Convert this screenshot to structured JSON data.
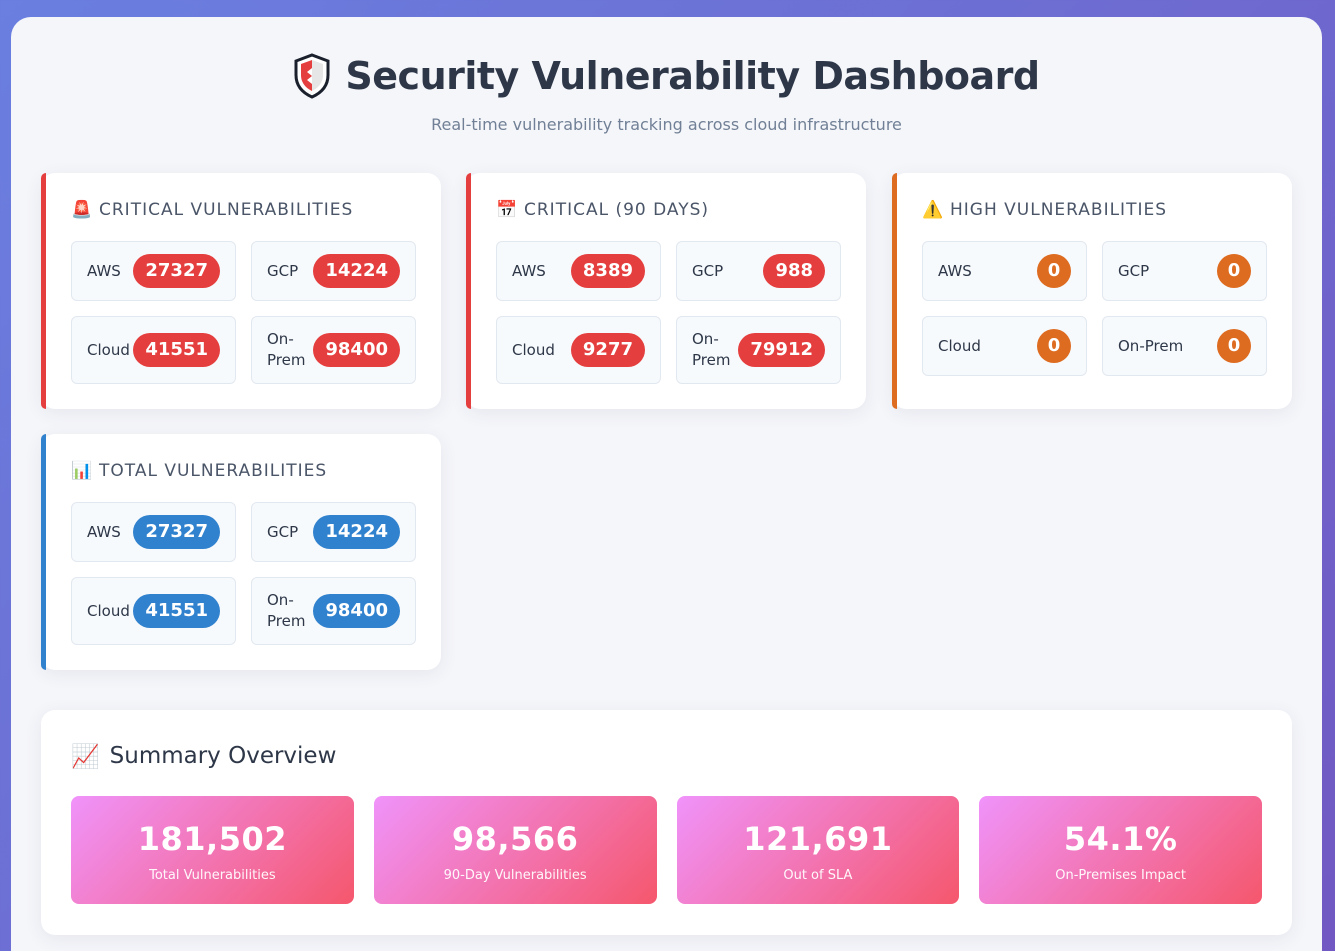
{
  "header": {
    "title": "Security Vulnerability Dashboard",
    "subtitle": "Real-time vulnerability tracking across cloud infrastructure",
    "icon": "shield-icon"
  },
  "colors": {
    "critical": "#e53e3e",
    "high": "#dd6b20",
    "total": "#3182ce",
    "summary_gradient_start": "#f093fb",
    "summary_gradient_end": "#f5576c"
  },
  "cards": {
    "critical": {
      "icon": "siren-icon",
      "icon_glyph": "🚨",
      "title": "Critical Vulnerabilities",
      "aws_label": "AWS",
      "aws_value": "27327",
      "gcp_label": "GCP",
      "gcp_value": "14224",
      "cloud_label": "Cloud",
      "cloud_value": "41551",
      "onprem_label": "On-Prem",
      "onprem_value": "98400"
    },
    "critical_90": {
      "icon": "calendar-icon",
      "icon_glyph": "📅",
      "title": "Critical (90 Days)",
      "aws_label": "AWS",
      "aws_value": "8389",
      "gcp_label": "GCP",
      "gcp_value": "988",
      "cloud_label": "Cloud",
      "cloud_value": "9277",
      "onprem_label": "On-Prem",
      "onprem_value": "79912"
    },
    "high": {
      "icon": "warning-icon",
      "icon_glyph": "⚠️",
      "title": "High Vulnerabilities",
      "aws_label": "AWS",
      "aws_value": "0",
      "gcp_label": "GCP",
      "gcp_value": "0",
      "cloud_label": "Cloud",
      "cloud_value": "0",
      "onprem_label": "On-Prem",
      "onprem_value": "0"
    },
    "total": {
      "icon": "bar-chart-icon",
      "icon_glyph": "📊",
      "title": "Total Vulnerabilities",
      "aws_label": "AWS",
      "aws_value": "27327",
      "gcp_label": "GCP",
      "gcp_value": "14224",
      "cloud_label": "Cloud",
      "cloud_value": "41551",
      "onprem_label": "On-Prem",
      "onprem_value": "98400"
    }
  },
  "summary": {
    "icon": "trend-chart-icon",
    "icon_glyph": "📈",
    "title": "Summary Overview",
    "stats": [
      {
        "value": "181,502",
        "caption": "Total Vulnerabilities"
      },
      {
        "value": "98,566",
        "caption": "90-Day Vulnerabilities"
      },
      {
        "value": "121,691",
        "caption": "Out of SLA"
      },
      {
        "value": "54.1%",
        "caption": "On-Premises Impact"
      }
    ]
  }
}
